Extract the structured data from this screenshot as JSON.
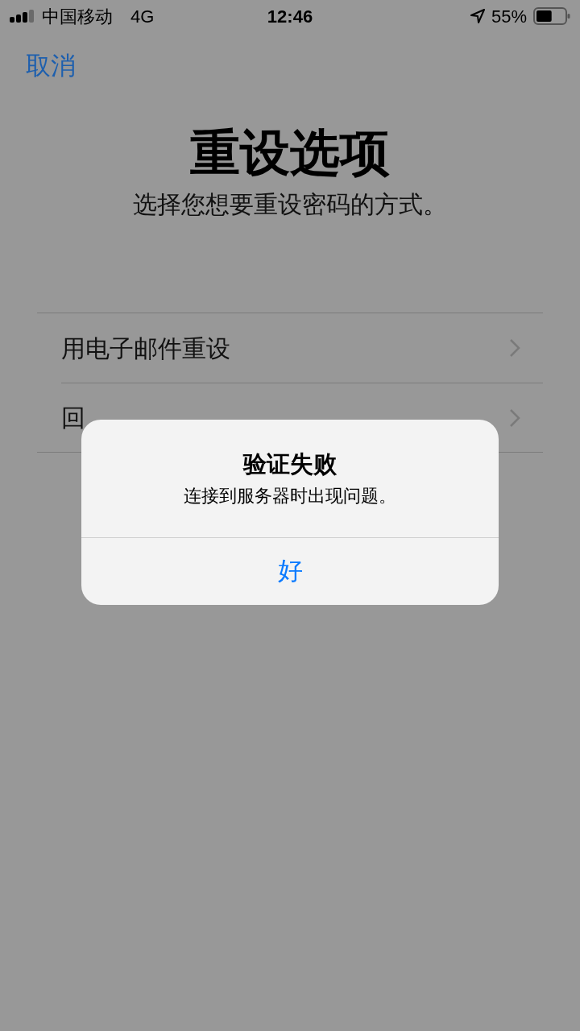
{
  "status_bar": {
    "carrier": "中国移动",
    "network": "4G",
    "time": "12:46",
    "battery": {
      "reading": "55%",
      "level": 0.55
    }
  },
  "nav": {
    "cancel": "取消"
  },
  "title": "重设选项",
  "subtitle": "选择您想要重设密码的方式。",
  "options": [
    {
      "label": "用电子邮件重设"
    },
    {
      "label": "回"
    }
  ],
  "alert": {
    "title": "验证失败",
    "message": "连接到服务器时出现问题。",
    "button": "好"
  }
}
